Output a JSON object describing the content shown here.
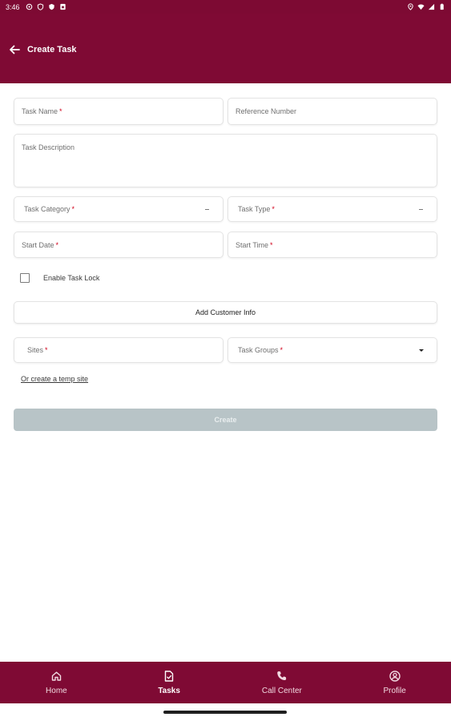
{
  "status_bar": {
    "time": "3:46"
  },
  "app_bar": {
    "title": "Create Task"
  },
  "form": {
    "task_name": {
      "label": "Task Name",
      "required": "*"
    },
    "reference_number": {
      "label": "Reference Number"
    },
    "task_description": {
      "label": "Task Description"
    },
    "task_category": {
      "label": "Task Category",
      "required": "*"
    },
    "task_type": {
      "label": "Task Type",
      "required": "*"
    },
    "start_date": {
      "label": "Start Date",
      "required": "*"
    },
    "start_time": {
      "label": "Start Time",
      "required": "*"
    },
    "enable_task_lock": {
      "label": "Enable Task Lock",
      "checked": false
    },
    "add_customer_info": {
      "label": "Add Customer Info"
    },
    "sites": {
      "label": "Sites",
      "required": "*"
    },
    "task_groups": {
      "label": "Task Groups",
      "required": "*"
    },
    "temp_site_link": "Or create a temp site",
    "create_button": "Create"
  },
  "colors": {
    "primary": "#7f0a34",
    "disabled_button": "#b8c4c7",
    "required": "#d0021b"
  },
  "bottom_nav": {
    "items": [
      {
        "label": "Home",
        "icon": "home-icon"
      },
      {
        "label": "Tasks",
        "icon": "task-document-icon",
        "active": true
      },
      {
        "label": "Call Center",
        "icon": "phone-icon"
      },
      {
        "label": "Profile",
        "icon": "profile-icon"
      }
    ]
  }
}
